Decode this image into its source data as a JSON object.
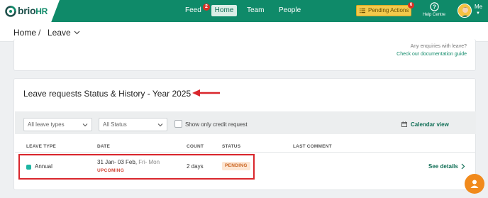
{
  "brand": {
    "name": "brio",
    "suffix": "HR"
  },
  "nav": {
    "feed": "Feed",
    "feed_badge": "2",
    "home": "Home",
    "team": "Team",
    "people": "People"
  },
  "pending": {
    "label": "Pending Actions",
    "badge": "6"
  },
  "help": {
    "label": "Help Centre"
  },
  "user": {
    "label": "Me"
  },
  "breadcrumb": {
    "home": "Home",
    "separator": "/",
    "current": "Leave"
  },
  "enquiry": {
    "text": "Any enquiries with leave?",
    "link": "Check our documentation guide"
  },
  "leave_section": {
    "title": "Leave requests Status & History - Year 2025",
    "filters": {
      "leave_type": "All leave types",
      "status": "All Status",
      "credit_only": "Show only credit request",
      "calendar": "Calendar view"
    },
    "columns": {
      "type": "LEAVE TYPE",
      "date": "DATE",
      "count": "COUNT",
      "status": "STATUS",
      "comment": "LAST COMMENT"
    },
    "rows": [
      {
        "type": "Annual",
        "date": "31 Jan- 03 Feb,",
        "days_of_week": "Fri- Mon",
        "tag": "UPCOMING",
        "count": "2 days",
        "status": "PENDING",
        "action": "See details"
      }
    ]
  },
  "colors": {
    "brand_green": "#0f8a69",
    "pending_yellow": "#f2c94c",
    "highlight_red": "#d9262c",
    "annual_teal": "#1cb5a3",
    "chat_orange": "#f18a1c"
  },
  "icons": [
    "brio-logo-icon",
    "pending-actions-icon",
    "help-icon",
    "avatar",
    "chevron-down-icon",
    "calendar-icon",
    "chevron-right-icon",
    "chat-icon",
    "annotation-arrow-icon"
  ]
}
